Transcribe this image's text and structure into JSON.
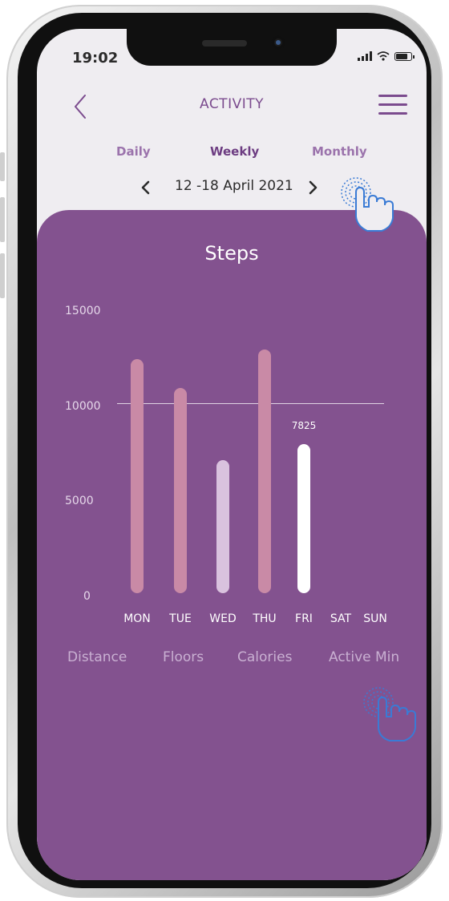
{
  "status_bar": {
    "time": "19:02"
  },
  "header": {
    "title": "ACTIVITY"
  },
  "tabs": [
    {
      "label": "Daily",
      "color": "#9b73ac"
    },
    {
      "label": "Weekly",
      "color": "#6d3d82"
    },
    {
      "label": "Monthly",
      "color": "#9b73ac"
    }
  ],
  "date_range": "12 -18 April 2021",
  "metrics": [
    "Distance",
    "Floors",
    "Calories",
    "Active Min"
  ],
  "colors": {
    "accent": "#7b4b8e",
    "card": "#83528f",
    "bar_over_goal": "#c98aa6",
    "bar_under_goal": "#d9c2de",
    "bar_selected": "#ffffff"
  },
  "chart_data": {
    "type": "bar",
    "title": "Steps",
    "categories": [
      "MON",
      "TUE",
      "WED",
      "THU",
      "FRI",
      "SAT",
      "SUN"
    ],
    "values": [
      12300,
      10800,
      7000,
      12800,
      7825,
      null,
      null
    ],
    "y_ticks": [
      "0",
      "5000",
      "10000",
      "15000"
    ],
    "ylim": [
      0,
      15000
    ],
    "goal_line": 10000,
    "selected": "FRI",
    "selected_label": "7825",
    "grid": false,
    "legend": "none"
  }
}
